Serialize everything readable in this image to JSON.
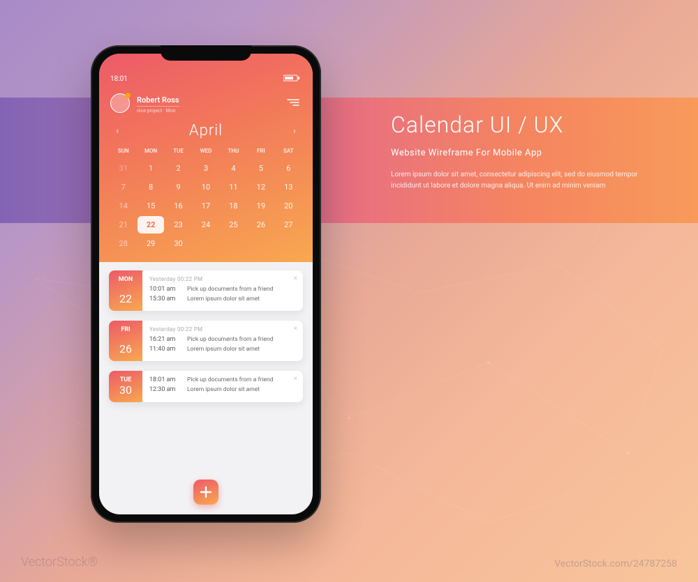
{
  "banner": {
    "title": "Calendar  UI / UX",
    "subtitle": "Website Wireframe For Mobile App",
    "body": "Lorem ipsum dolor sit amet, consectetur adipiscing elit, sed do eiusmod tempor incididunt ut labore et dolore magna aliqua. Ut enim ad minim veniam"
  },
  "statusbar": {
    "time": "18:01"
  },
  "profile": {
    "name": "Robert Ross",
    "meta": "nice project · Mon"
  },
  "calendar": {
    "month": "April",
    "weekdays": [
      "SUN",
      "MON",
      "TUE",
      "WED",
      "THU",
      "FRI",
      "SAT"
    ],
    "rows": [
      [
        {
          "n": "31",
          "dim": true
        },
        {
          "n": "1"
        },
        {
          "n": "2"
        },
        {
          "n": "3"
        },
        {
          "n": "4"
        },
        {
          "n": "5"
        },
        {
          "n": "6"
        }
      ],
      [
        {
          "n": "7",
          "sun": true
        },
        {
          "n": "8"
        },
        {
          "n": "9"
        },
        {
          "n": "10"
        },
        {
          "n": "11"
        },
        {
          "n": "12"
        },
        {
          "n": "13"
        }
      ],
      [
        {
          "n": "14",
          "sun": true
        },
        {
          "n": "15"
        },
        {
          "n": "16"
        },
        {
          "n": "17"
        },
        {
          "n": "18"
        },
        {
          "n": "19"
        },
        {
          "n": "20"
        }
      ],
      [
        {
          "n": "21",
          "sun": true
        },
        {
          "n": "22",
          "selected": true
        },
        {
          "n": "23"
        },
        {
          "n": "24"
        },
        {
          "n": "25"
        },
        {
          "n": "26"
        },
        {
          "n": "27"
        }
      ],
      [
        {
          "n": "28",
          "sun": true
        },
        {
          "n": "29"
        },
        {
          "n": "30"
        },
        {
          "n": "",
          "dim": true
        },
        {
          "n": "",
          "dim": true
        },
        {
          "n": "",
          "dim": true
        },
        {
          "n": "",
          "dim": true
        }
      ]
    ]
  },
  "events": [
    {
      "day": "MON",
      "num": "22",
      "header": "Yesterday 00:22   PM",
      "items": [
        {
          "time": "10:01 am",
          "title": "Pick up documents from a friend",
          "desc": ""
        },
        {
          "time": "15:30 am",
          "title": "Lorem ipsum dolor sit amet",
          "desc": ""
        }
      ]
    },
    {
      "day": "FRI",
      "num": "26",
      "header": "Yesterday 00:22   PM",
      "items": [
        {
          "time": "16:21 am",
          "title": "Pick up documents from a friend",
          "desc": ""
        },
        {
          "time": "11:40 am",
          "title": "Lorem ipsum dolor sit amet",
          "desc": ""
        }
      ]
    },
    {
      "day": "TUE",
      "num": "30",
      "header": "",
      "items": [
        {
          "time": "18:01 am",
          "title": "Pick up documents from a friend",
          "desc": ""
        },
        {
          "time": "12:30 am",
          "title": "Lorem ipsum dolor sit amet",
          "desc": ""
        }
      ]
    }
  ],
  "watermark": {
    "brand": "VectorStock®",
    "id": "VectorStock.com/24787258"
  }
}
